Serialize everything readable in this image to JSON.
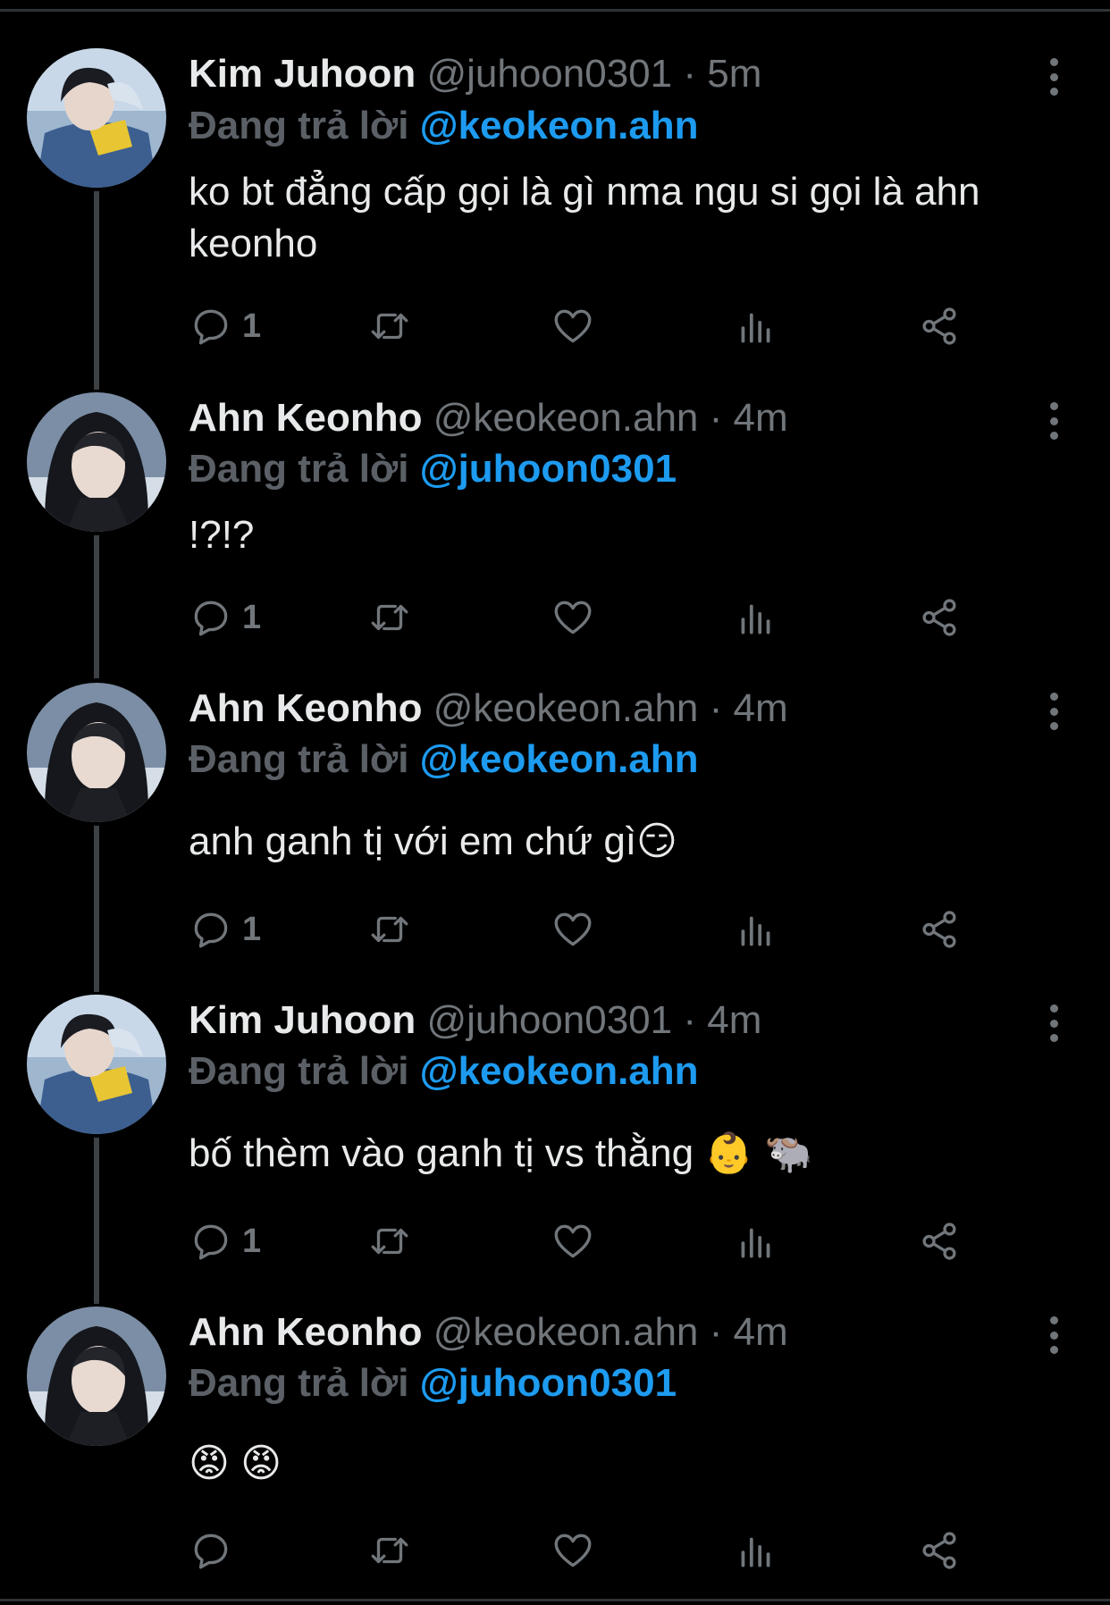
{
  "thread": [
    {
      "name": "Kim Juhoon",
      "handle": "@juhoon0301",
      "time": "· 5m",
      "replying_label": "Đang trả lời",
      "replying_to": "@keokeon.ahn",
      "text": "ko bt đẳng cấp gọi là gì nma ngu si gọi là ahn keonho",
      "reply_count": "1",
      "avatar_style": "juhoon"
    },
    {
      "name": "Ahn Keonho",
      "handle": "@keokeon.ahn",
      "time": "· 4m",
      "replying_label": "Đang trả lời",
      "replying_to": "@juhoon0301",
      "text": "!?!?",
      "reply_count": "1",
      "avatar_style": "keonho"
    },
    {
      "name": "Ahn Keonho",
      "handle": "@keokeon.ahn",
      "time": "· 4m",
      "replying_label": "Đang trả lời",
      "replying_to": "@keokeon.ahn",
      "text": "anh ganh tị với em chứ gì😏",
      "reply_count": "1",
      "avatar_style": "keonho"
    },
    {
      "name": "Kim Juhoon",
      "handle": "@juhoon0301",
      "time": "· 4m",
      "replying_label": "Đang trả lời",
      "replying_to": "@keokeon.ahn",
      "text": "bố thèm vào ganh tị vs thằng 👶 🐃",
      "reply_count": "1",
      "avatar_style": "juhoon"
    },
    {
      "name": "Ahn Keonho",
      "handle": "@keokeon.ahn",
      "time": "· 4m",
      "replying_label": "Đang trả lời",
      "replying_to": "@juhoon0301",
      "text": "😡 😡",
      "reply_count": "",
      "avatar_style": "keonho"
    }
  ],
  "icons": {
    "reply": "reply-icon",
    "retweet": "retweet-icon",
    "like": "heart-icon",
    "views": "views-icon",
    "share": "share-icon",
    "more": "more-icon"
  },
  "colors": {
    "background": "#000000",
    "text": "#e7e9ea",
    "muted": "#71767b",
    "mention": "#1d9bf0"
  }
}
